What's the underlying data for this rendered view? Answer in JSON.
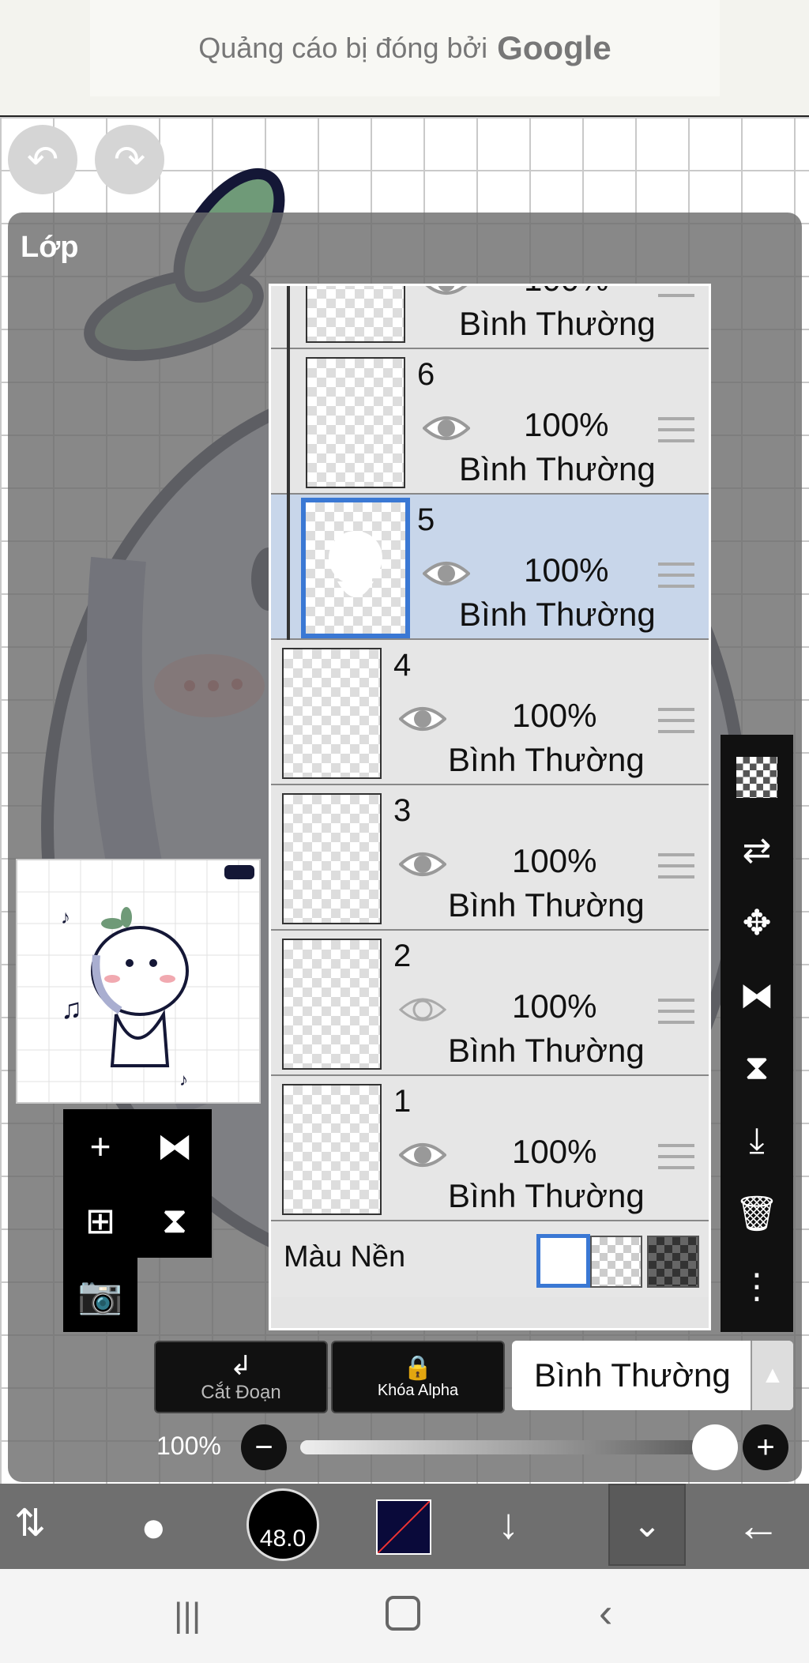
{
  "ad": {
    "text": "Quảng cáo bị đóng bởi",
    "brand": "Google"
  },
  "panel": {
    "title": "Lớp"
  },
  "layers": [
    {
      "name": "",
      "opacity": "100%",
      "mode": "Bình Thường"
    },
    {
      "name": "6",
      "opacity": "100%",
      "mode": "Bình Thường"
    },
    {
      "name": "5",
      "opacity": "100%",
      "mode": "Bình Thường",
      "selected": true
    },
    {
      "name": "4",
      "opacity": "100%",
      "mode": "Bình Thường"
    },
    {
      "name": "3",
      "opacity": "100%",
      "mode": "Bình Thường"
    },
    {
      "name": "2",
      "opacity": "100%",
      "mode": "Bình Thường",
      "hidden": true
    },
    {
      "name": "1",
      "opacity": "100%",
      "mode": "Bình Thường"
    }
  ],
  "background_row": {
    "label": "Màu Nền"
  },
  "controls": {
    "clip_label": "Cắt Đoạn",
    "alpha_lock_label": "Khóa Alpha",
    "blend_mode": "Bình Thường",
    "opacity_label": "100%",
    "opacity_value": 1.0
  },
  "brush": {
    "size": "48.0"
  },
  "colors": {
    "accent": "#3a78d4",
    "selected_row": "#c8d6ea",
    "primary_color": "#0a0a3a"
  }
}
